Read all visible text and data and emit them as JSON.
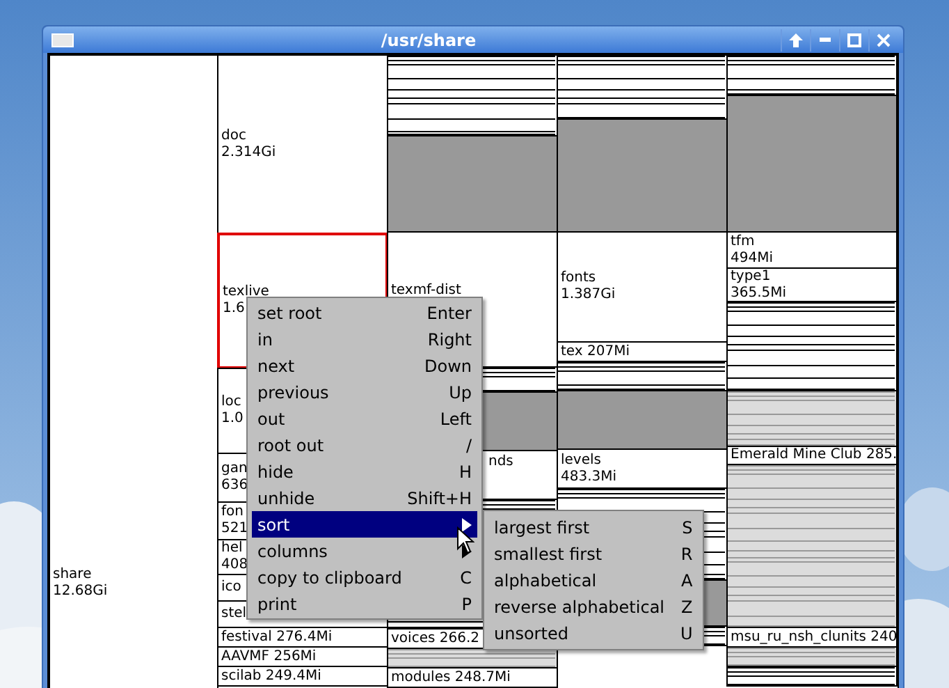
{
  "window": {
    "title": "/usr/share"
  },
  "columns": [
    {
      "cells": [
        {
          "kind": "block",
          "name": "share",
          "size": "12.68Gi",
          "selected": false
        }
      ]
    },
    {
      "cells": [
        {
          "kind": "block",
          "name": "doc",
          "size": "2.314Gi",
          "selected": false
        },
        {
          "kind": "block",
          "name": "texlive",
          "size": "1.6",
          "selected": true
        },
        {
          "kind": "block",
          "name": "loc",
          "size": "1.0",
          "selected": false
        },
        {
          "kind": "block",
          "name": "gan",
          "size": "636",
          "selected": false
        },
        {
          "kind": "block",
          "name": "fon",
          "size": "521",
          "selected": false
        },
        {
          "kind": "block",
          "name": "hel",
          "size": "408",
          "selected": false
        },
        {
          "kind": "line",
          "name": "ico",
          "selected": false
        },
        {
          "kind": "line",
          "name": "stel",
          "selected": false
        },
        {
          "kind": "line",
          "name": "festival",
          "size": "276.4Mi",
          "selected": false
        },
        {
          "kind": "line",
          "name": "AAVMF",
          "size": "256Mi",
          "selected": false
        },
        {
          "kind": "line",
          "name": "scilab",
          "size": "249.4Mi",
          "selected": false
        }
      ]
    },
    {
      "cells": [
        {
          "kind": "lines",
          "selected": false
        },
        {
          "kind": "shade",
          "selected": false
        },
        {
          "kind": "block",
          "name": "texmf-dist",
          "selected": false
        },
        {
          "kind": "lines",
          "selected": false
        },
        {
          "kind": "shade",
          "selected": false
        },
        {
          "kind": "covered",
          "name": "nds",
          "selected": false
        },
        {
          "kind": "lines",
          "selected": false
        },
        {
          "kind": "line",
          "name": "voices",
          "size": "266.2",
          "selected": false
        },
        {
          "kind": "pale",
          "selected": false
        },
        {
          "kind": "line",
          "name": "modules",
          "size": "248.7Mi",
          "selected": false
        }
      ]
    },
    {
      "cells": [
        {
          "kind": "lines",
          "selected": false
        },
        {
          "kind": "shade",
          "selected": false
        },
        {
          "kind": "block",
          "name": "fonts",
          "size": "1.387Gi",
          "selected": false
        },
        {
          "kind": "line",
          "name": "tex",
          "size": "207Mi",
          "selected": false
        },
        {
          "kind": "lines",
          "selected": false
        },
        {
          "kind": "shade",
          "selected": false
        },
        {
          "kind": "block",
          "name": "levels",
          "size": "483.3Mi",
          "selected": false
        },
        {
          "kind": "lines",
          "selected": false
        },
        {
          "kind": "shade",
          "selected": false
        },
        {
          "kind": "lines",
          "selected": false
        }
      ]
    },
    {
      "cells": [
        {
          "kind": "lines",
          "selected": false
        },
        {
          "kind": "shade",
          "selected": false
        },
        {
          "kind": "block",
          "name": "tfm",
          "size": "494Mi",
          "selected": false
        },
        {
          "kind": "block",
          "name": "type1",
          "size": "365.5Mi",
          "selected": false
        },
        {
          "kind": "lines",
          "selected": false
        },
        {
          "kind": "pale",
          "selected": false
        },
        {
          "kind": "line",
          "name": "Emerald Mine Club",
          "size": "285.",
          "selected": false
        },
        {
          "kind": "pale",
          "selected": false
        },
        {
          "kind": "line",
          "name": "msu_ru_nsh_clunits",
          "size": "240",
          "selected": false
        },
        {
          "kind": "pale",
          "selected": false
        },
        {
          "kind": "lines",
          "selected": false
        }
      ]
    }
  ],
  "menu": [
    {
      "label": "set root",
      "shortcut": "Enter",
      "submenu": false,
      "selected": false
    },
    {
      "label": "in",
      "shortcut": "Right",
      "submenu": false,
      "selected": false
    },
    {
      "label": "next",
      "shortcut": "Down",
      "submenu": false,
      "selected": false
    },
    {
      "label": "previous",
      "shortcut": "Up",
      "submenu": false,
      "selected": false
    },
    {
      "label": "out",
      "shortcut": "Left",
      "submenu": false,
      "selected": false
    },
    {
      "label": "root out",
      "shortcut": "/",
      "submenu": false,
      "selected": false
    },
    {
      "label": "hide",
      "shortcut": "H",
      "submenu": false,
      "selected": false
    },
    {
      "label": "unhide",
      "shortcut": "Shift+H",
      "submenu": false,
      "selected": false
    },
    {
      "label": "sort",
      "submenu": true,
      "selected": true
    },
    {
      "label": "columns",
      "submenu": true,
      "selected": false
    },
    {
      "label": "copy to clipboard",
      "shortcut": "C",
      "submenu": false,
      "selected": false
    },
    {
      "label": "print",
      "shortcut": "P",
      "submenu": false,
      "selected": false
    }
  ],
  "submenu": [
    {
      "label": "largest first",
      "shortcut": "S"
    },
    {
      "label": "smallest first",
      "shortcut": "R"
    },
    {
      "label": "alphabetical",
      "shortcut": "A"
    },
    {
      "label": "reverse alphabetical",
      "shortcut": "Z"
    },
    {
      "label": "unsorted",
      "shortcut": "U"
    }
  ]
}
